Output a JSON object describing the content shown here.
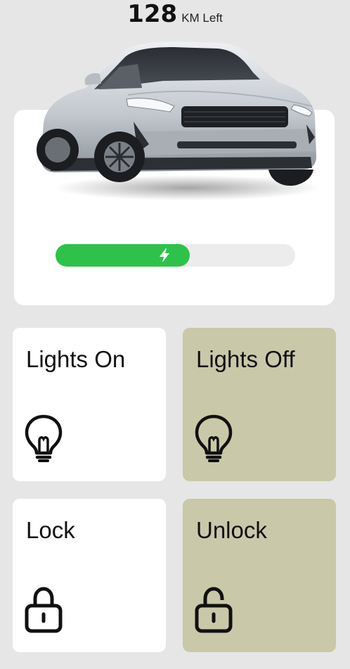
{
  "range": {
    "value": "128",
    "unit": "KM Left"
  },
  "battery": {
    "level_percent": 56,
    "icon": "lightning-bolt-icon",
    "fill_color": "#2ec24a"
  },
  "hero": {
    "image": "car-image"
  },
  "controls": {
    "lights_on": {
      "label": "Lights On",
      "icon": "lightbulb-icon"
    },
    "lights_off": {
      "label": "Lights Off",
      "icon": "lightbulb-icon"
    },
    "lock": {
      "label": "Lock",
      "icon": "padlock-closed-icon"
    },
    "unlock": {
      "label": "Unlock",
      "icon": "padlock-open-icon"
    }
  },
  "colors": {
    "background": "#e6e6e6",
    "card": "#ffffff",
    "accent_tile": "#c9c8a8"
  }
}
